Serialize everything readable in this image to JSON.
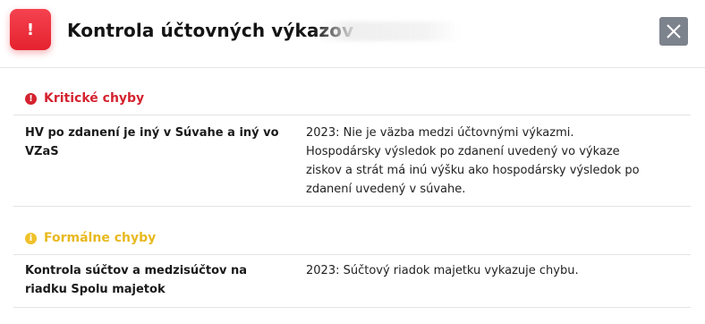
{
  "dialog": {
    "title": "Kontrola účtovných výkazov",
    "alert_icon_text": "!",
    "close_icon": "close-icon"
  },
  "sections": [
    {
      "title": "Kritické chyby",
      "icon": "error-icon",
      "icon_text": "!",
      "color": "#d4232f",
      "rows": [
        {
          "label": "HV po zdanení je iný v Súvahe a iný vo VZaS",
          "description": "2023: Nie je väzba medzi účtovnými výkazmi. Hospodársky výsledok po zdanení uvedený vo výkaze ziskov a strát má inú výšku ako hospodársky výsledok po zdanení uvedený v súvahe."
        }
      ]
    },
    {
      "title": "Formálne chyby",
      "icon": "warning-icon",
      "icon_text": "i",
      "color": "#e8b920",
      "rows": [
        {
          "label": "Kontrola súčtov a medzisúčtov na riadku Spolu majetok",
          "description": "2023: Súčtový riadok majetku vykazuje chybu."
        }
      ]
    }
  ]
}
